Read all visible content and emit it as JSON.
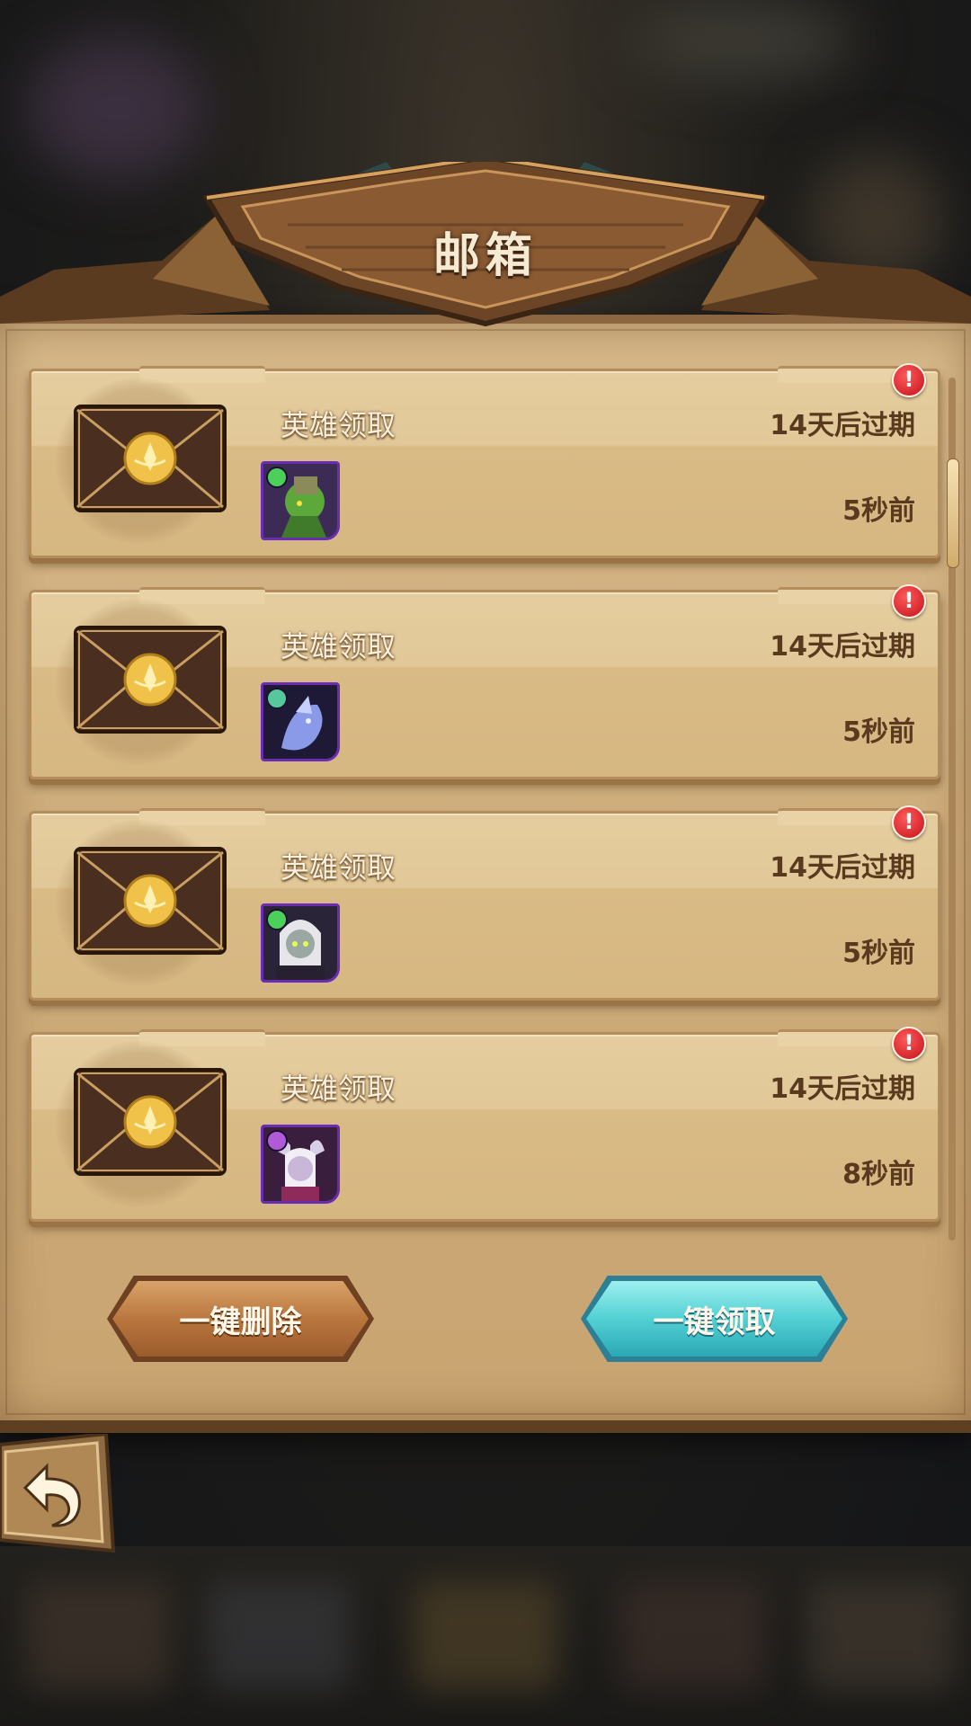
{
  "header": {
    "title": "邮箱"
  },
  "mails": [
    {
      "subject": "英雄领取",
      "expire": "14天后过期",
      "time": "5秒前",
      "badge": "!",
      "hero_icon": "green-goblin-hero-icon",
      "faction_color": "#4bd05a"
    },
    {
      "subject": "英雄领取",
      "expire": "14天后过期",
      "time": "5秒前",
      "badge": "!",
      "hero_icon": "blue-dragon-hero-icon",
      "faction_color": "#56c89a"
    },
    {
      "subject": "英雄领取",
      "expire": "14天后过期",
      "time": "5秒前",
      "badge": "!",
      "hero_icon": "silver-hair-hero-icon",
      "faction_color": "#4bd05a"
    },
    {
      "subject": "英雄领取",
      "expire": "14天后过期",
      "time": "8秒前",
      "badge": "!",
      "hero_icon": "horned-demon-hero-icon",
      "faction_color": "#b05ad8"
    }
  ],
  "buttons": {
    "delete_all": "一键删除",
    "claim_all": "一键领取"
  },
  "colors": {
    "panel": "#d4b37f",
    "claim_button": "#52d0d4",
    "delete_button": "#b9763e",
    "badge": "#d41e24"
  }
}
